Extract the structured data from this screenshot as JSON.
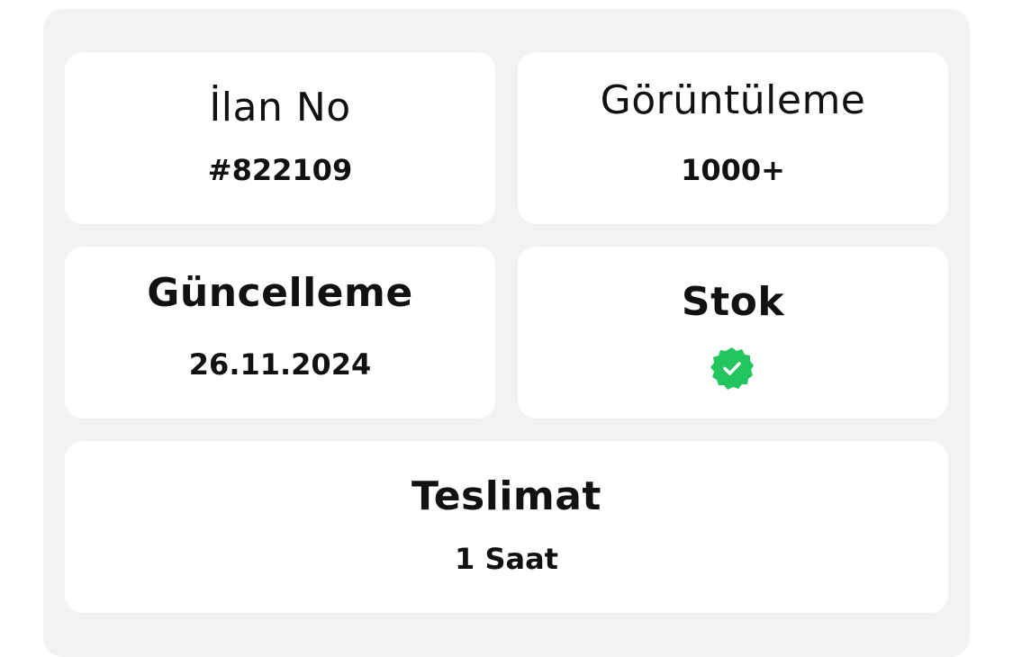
{
  "cards": {
    "listing_no": {
      "title": "İlan No",
      "value": "#822109"
    },
    "views": {
      "title": "Görüntüleme",
      "value": "1000+"
    },
    "updated": {
      "title": "Güncelleme",
      "value": "26.11.2024"
    },
    "stock": {
      "title": "Stok",
      "status_icon": "verified-check-icon",
      "status_color": "#22c55e"
    },
    "delivery": {
      "title": "Teslimat",
      "value": "1 Saat"
    }
  },
  "colors": {
    "panel_bg": "#f1f2f4",
    "card_bg": "#ffffff",
    "text": "#111111",
    "success": "#22c55e"
  }
}
